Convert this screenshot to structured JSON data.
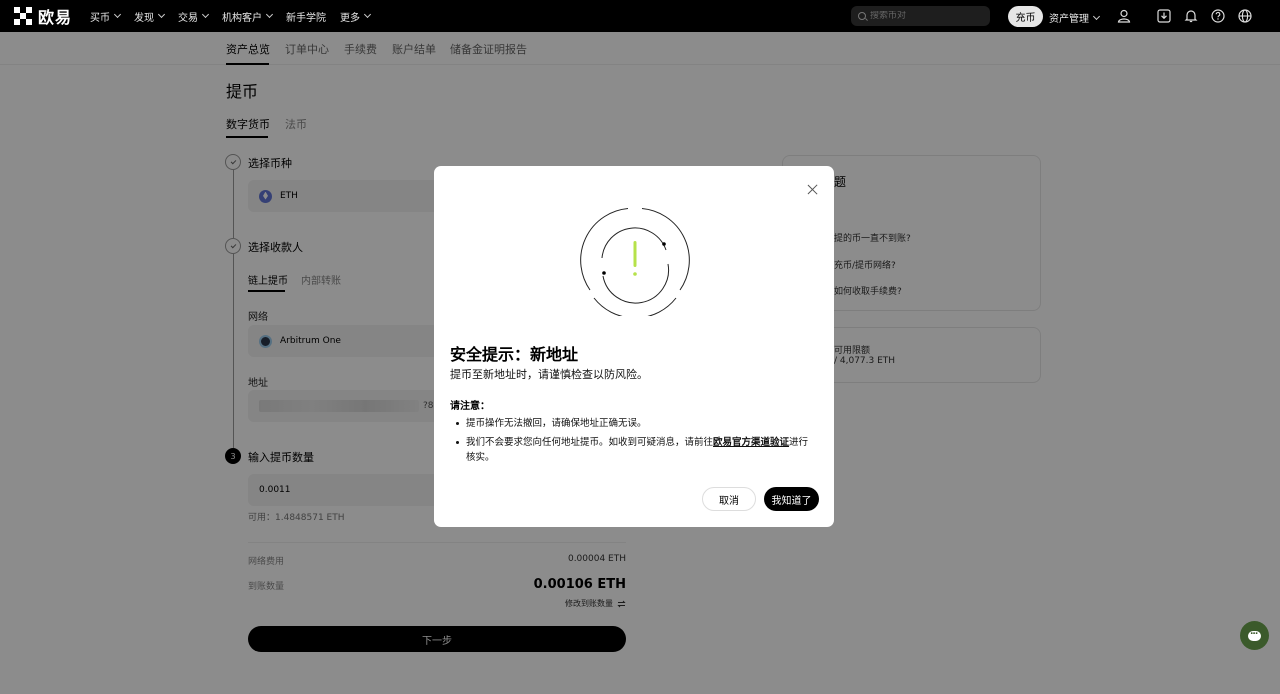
{
  "brand": {
    "name": "欧易"
  },
  "topnav": {
    "items": [
      "买币",
      "发现",
      "交易",
      "机构客户",
      "新手学院",
      "更多"
    ],
    "search_placeholder": "搜索币对",
    "deposit_label": "充币",
    "asset_mgmt_label": "资产管理"
  },
  "subnav": {
    "items": [
      "资产总览",
      "订单中心",
      "手续费",
      "账户结单",
      "储备金证明报告"
    ]
  },
  "page": {
    "title": "提币",
    "tabs": [
      "数字货币",
      "法币"
    ],
    "step1": {
      "title": "选择币种",
      "coin": "ETH"
    },
    "step2": {
      "title": "选择收款人",
      "sub_tabs": [
        "链上提币",
        "内部转账"
      ],
      "network_label": "网络",
      "network_value": "Arbitrum One",
      "address_label": "地址",
      "address_suffix": "?8"
    },
    "step3": {
      "number": "3",
      "title": "输入提币数量",
      "amount": "0.0011",
      "available": "可用：1.4848571 ETH"
    },
    "fee_label": "网络费用",
    "fee_value": "0.00004 ETH",
    "receive_label": "到账数量",
    "receive_value": "0.00106 ETH",
    "edit_receive": "修改到账数量",
    "next_label": "下一步"
  },
  "side": {
    "faq_title_partial": "题",
    "faq_items": [
      "提的币一直不到账?",
      "充币/提币网络?",
      "如何收取手续费?"
    ],
    "limit_label": "可用限额",
    "limit_value": "/ 4,077.3 ETH"
  },
  "modal": {
    "title": "安全提示：新地址",
    "subtitle": "提币至新地址时，请谨慎检查以防风险。",
    "note_title": "请注意：",
    "note1": "提币操作无法撤回，请确保地址正确无误。",
    "note2_before": "我们不会要求您向任何地址提币。如收到可疑消息，请前往",
    "note2_link": "欧易官方渠道验证",
    "note2_after": "进行核实。",
    "cancel_label": "取消",
    "ok_label": "我知道了"
  },
  "colors": {
    "accent_green": "#b6e24a",
    "chat_fab": "#3b5a2b"
  }
}
